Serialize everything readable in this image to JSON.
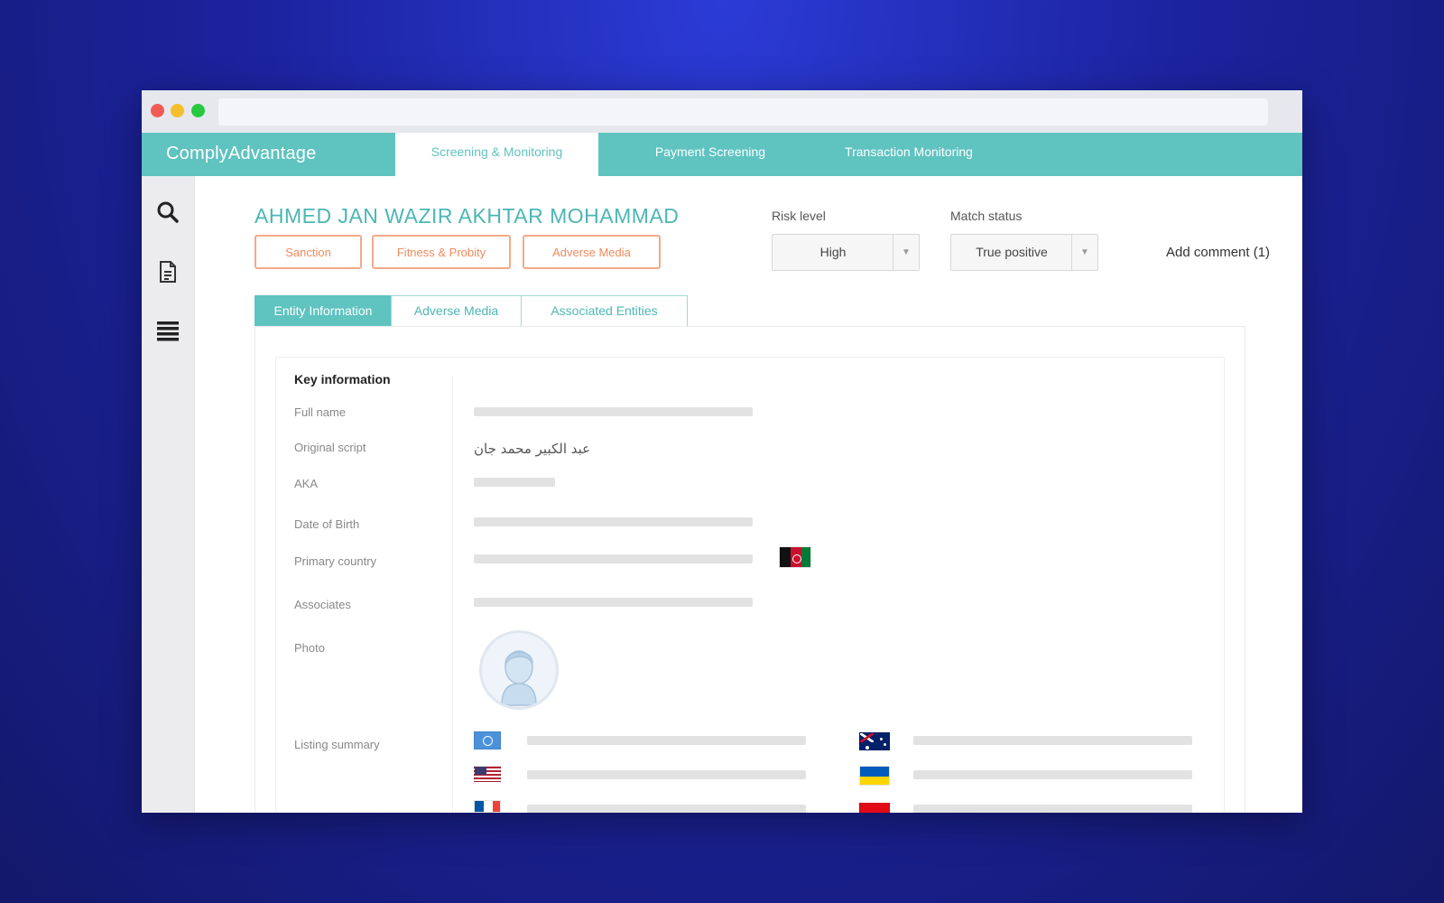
{
  "app": {
    "brand": "ComplyAdvantage",
    "nav_tabs": [
      {
        "label": "Screening & Monitoring",
        "active": true
      },
      {
        "label": "Payment Screening",
        "active": false
      },
      {
        "label": "Transaction Monitoring",
        "active": false
      }
    ]
  },
  "sidebar": {
    "icons": [
      "search-icon",
      "document-icon",
      "list-icon"
    ]
  },
  "entity": {
    "name": "AHMED JAN WAZIR AKHTAR MOHAMMAD",
    "tags": [
      "Sanction",
      "Fitness & Probity",
      "Adverse Media"
    ]
  },
  "controls": {
    "risk_level_label": "Risk level",
    "risk_level_value": "High",
    "match_status_label": "Match status",
    "match_status_value": "True positive",
    "add_comment": "Add comment (1)"
  },
  "subtabs": [
    {
      "label": "Entity Information",
      "active": true
    },
    {
      "label": "Adverse Media",
      "active": false
    },
    {
      "label": "Associated Entities",
      "active": false
    }
  ],
  "key_information": {
    "title": "Key information",
    "rows": [
      {
        "label": "Full name"
      },
      {
        "label": "Original script",
        "value": "عبد الكبير محمد جان"
      },
      {
        "label": "AKA"
      },
      {
        "label": "Date of Birth"
      },
      {
        "label": "Primary country",
        "flag": "afghanistan-flag"
      },
      {
        "label": "Associates"
      },
      {
        "label": "Photo"
      },
      {
        "label": "Listing summary"
      }
    ],
    "listing_flags_left": [
      "un-flag",
      "usa-flag",
      "france-flag"
    ],
    "listing_flags_right": [
      "australia-flag",
      "ukraine-flag",
      "turkey-flag"
    ]
  },
  "colors": {
    "teal": "#5fc3c0",
    "orange": "#f08a5d",
    "background": "#1c239f"
  }
}
